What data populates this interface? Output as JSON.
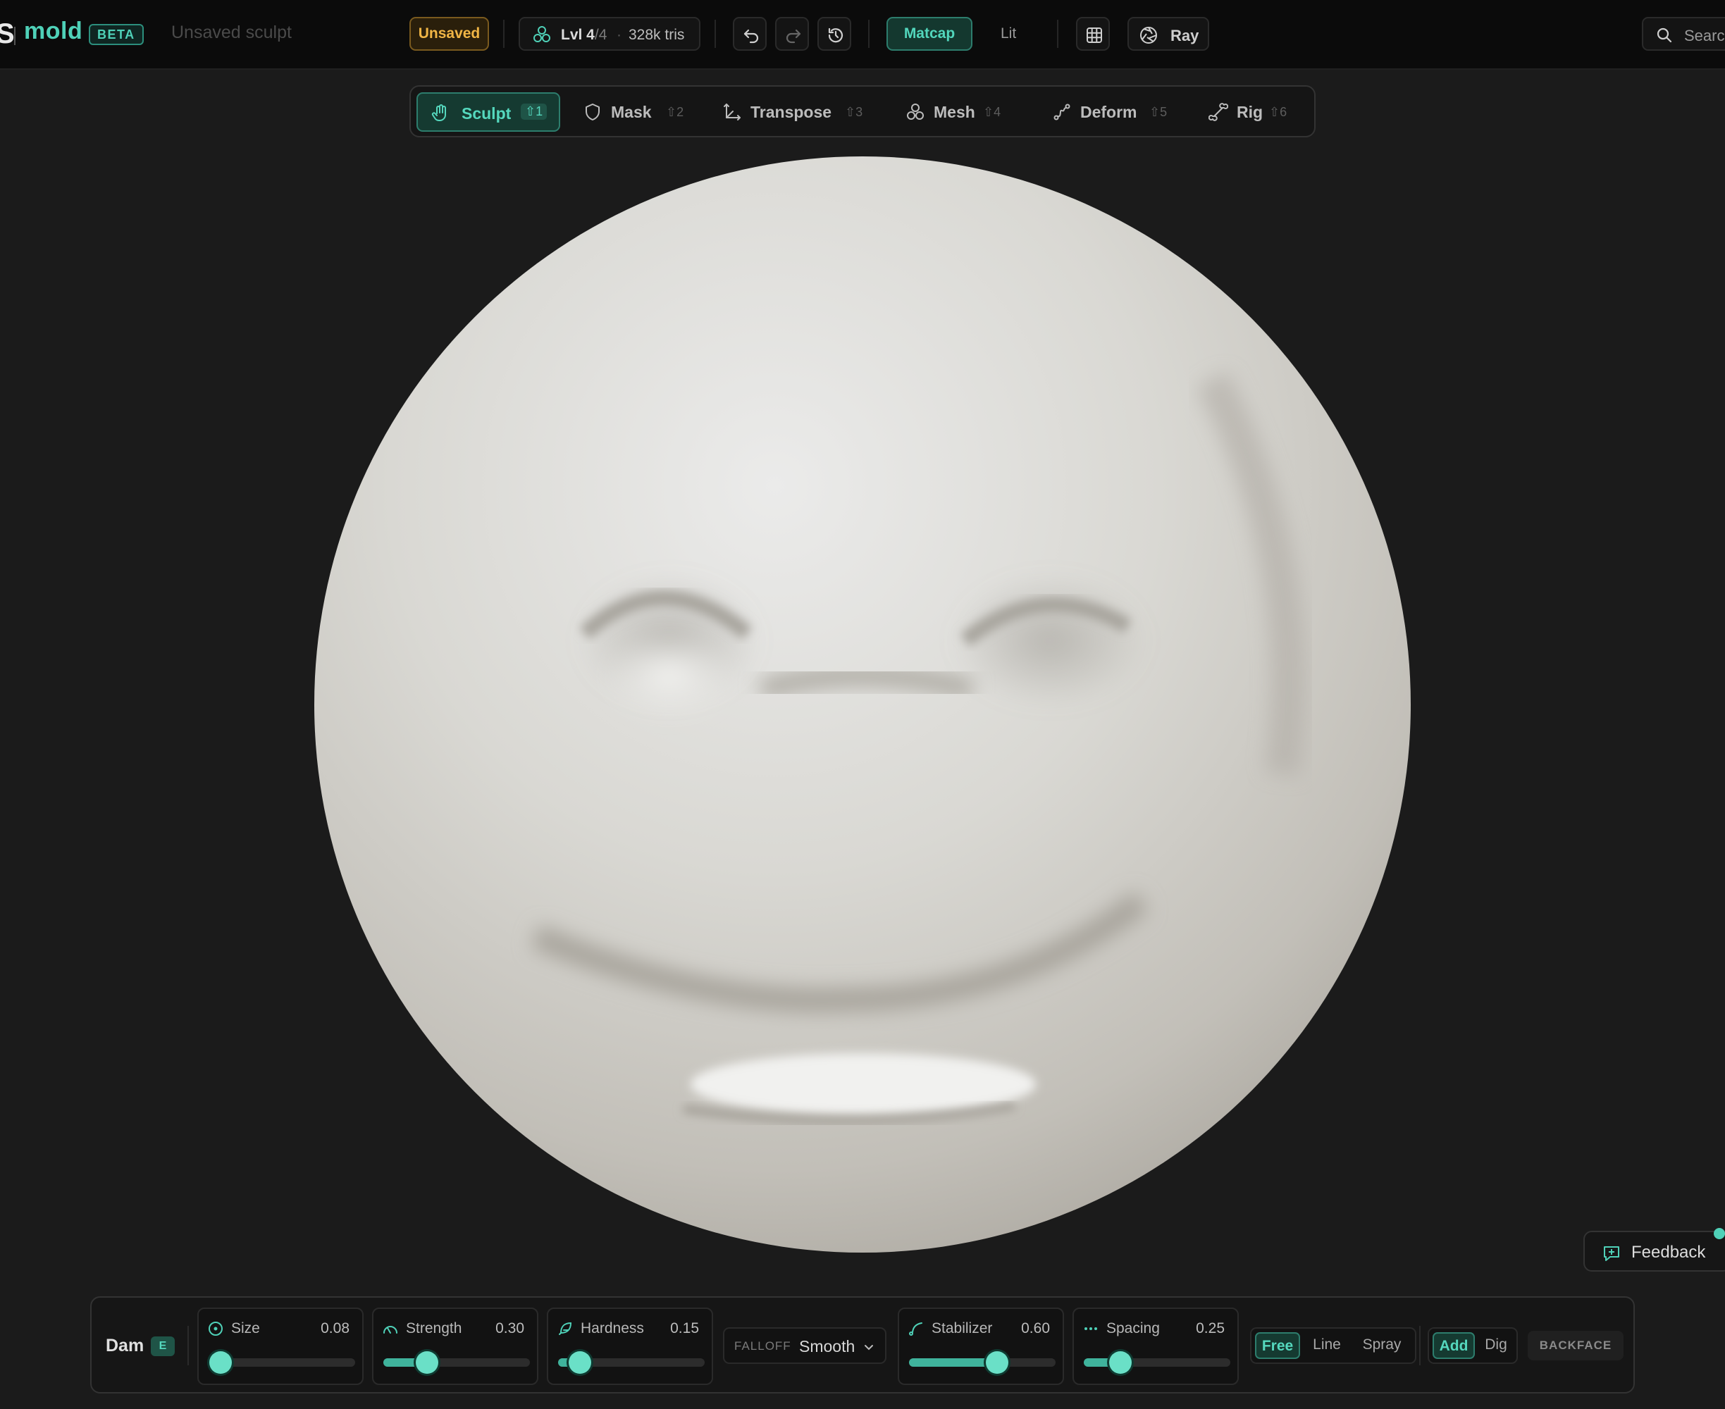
{
  "app": {
    "logo_fragment": "S",
    "name": "mold",
    "badge": "BETA",
    "document_title": "Unsaved sculpt"
  },
  "topbar": {
    "status": "Unsaved",
    "level_label": "Lvl 4",
    "level_total": "/4",
    "separator": "·",
    "tris": "328k tris",
    "shading_modes": [
      "Matcap",
      "Lit"
    ],
    "active_shading": "Matcap",
    "ray_label": "Ray",
    "search_label": "Search"
  },
  "modes": [
    {
      "label": "Sculpt",
      "shortcut": "⇧1",
      "active": true
    },
    {
      "label": "Mask",
      "shortcut": "⇧2",
      "active": false
    },
    {
      "label": "Transpose",
      "shortcut": "⇧3",
      "active": false
    },
    {
      "label": "Mesh",
      "shortcut": "⇧4",
      "active": false
    },
    {
      "label": "Deform",
      "shortcut": "⇧5",
      "active": false
    },
    {
      "label": "Rig",
      "shortcut": "⇧6",
      "active": false
    }
  ],
  "brush": {
    "name": "Dam",
    "key": "E",
    "sliders": [
      {
        "label": "Size",
        "value": "0.08",
        "fraction": 0.08,
        "icon": "circle-dot-icon"
      },
      {
        "label": "Strength",
        "value": "0.30",
        "fraction": 0.3,
        "icon": "gauge-icon"
      },
      {
        "label": "Hardness",
        "value": "0.15",
        "fraction": 0.15,
        "icon": "feather-icon"
      },
      {
        "label": "Stabilizer",
        "value": "0.60",
        "fraction": 0.6,
        "icon": "curve-icon"
      },
      {
        "label": "Spacing",
        "value": "0.25",
        "fraction": 0.25,
        "icon": "dots-icon"
      }
    ],
    "falloff_label": "FALLOFF",
    "falloff_value": "Smooth",
    "stroke_modes": [
      "Free",
      "Line",
      "Spray"
    ],
    "active_stroke": "Free",
    "direction_modes": [
      "Add",
      "Dig"
    ],
    "active_direction": "Add",
    "backface_label": "BACKFACE"
  },
  "feedback_label": "Feedback",
  "colors": {
    "accent": "#4fd1b8",
    "warning": "#f0b545",
    "background": "#1b1b1b",
    "clay": "#d8d6d0"
  }
}
